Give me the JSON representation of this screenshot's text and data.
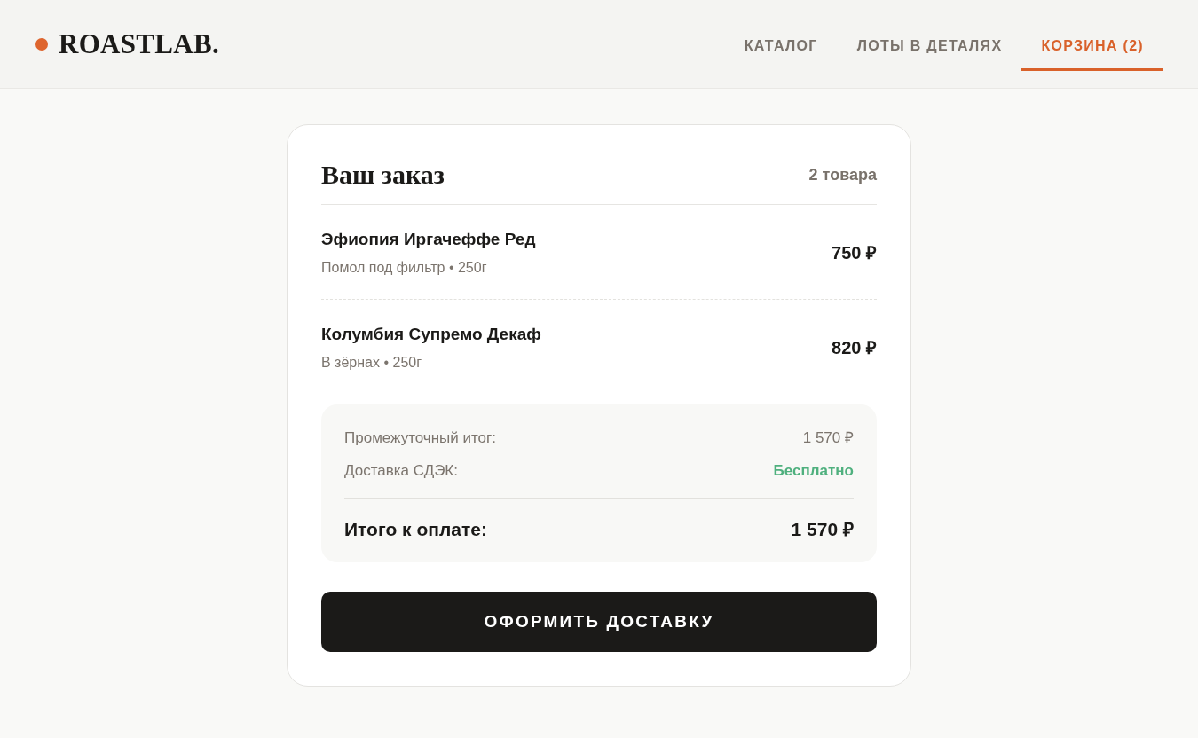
{
  "header": {
    "logo": "ROASTLAB.",
    "nav": [
      {
        "label": "КАТАЛОГ",
        "selected": false
      },
      {
        "label": "ЛОТЫ В ДЕТАЛЯХ",
        "selected": false
      },
      {
        "label": "КОРЗИНА (2)",
        "selected": true
      }
    ]
  },
  "order": {
    "title": "Ваш заказ",
    "count": "2 товара",
    "items": [
      {
        "name": "Эфиопия Иргачеффе Ред",
        "details": "Помол под фильтр • 250г",
        "price": "750 ₽"
      },
      {
        "name": "Колумбия Супремо Декаф",
        "details": "В зёрнах • 250г",
        "price": "820 ₽"
      }
    ],
    "summary": {
      "lines": [
        {
          "kind": "plain",
          "label": "Промежуточный итог:",
          "value": "1 570 ₽"
        },
        {
          "kind": "free",
          "label": "Доставка СДЭК:",
          "value": "Бесплатно"
        }
      ],
      "total": {
        "label": "Итого к оплате:",
        "value": "1 570 ₽"
      }
    },
    "button": "ОФОРМИТЬ ДОСТАВКУ"
  }
}
